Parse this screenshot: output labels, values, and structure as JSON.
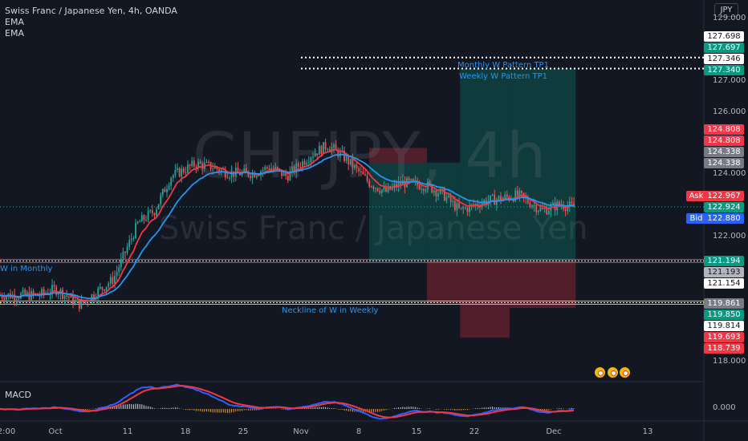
{
  "header": {
    "title_line": "Swiss Franc / Japanese Yen, 4h, OANDA",
    "indicators": [
      "EMA",
      "EMA"
    ]
  },
  "watermark": {
    "symbol": "CHFJPY, 4h",
    "name": "Swiss Franc / Japanese Yen"
  },
  "currency": "JPY",
  "colors": {
    "background": "#131722",
    "up": "#26a69a",
    "down": "#ef5350",
    "ema_fast": "#f23645",
    "ema_slow": "#2196f3",
    "neckline": "#f0d000",
    "annotation": "#2196f3"
  },
  "price_axis": {
    "ticks": [
      "129.000",
      "127.000",
      "126.000",
      "124.000",
      "122.000",
      "118.000"
    ],
    "tags": [
      {
        "value": "127.698",
        "style": "dark"
      },
      {
        "value": "127.697",
        "style": "green"
      },
      {
        "value": "127.346",
        "style": "dark"
      },
      {
        "value": "127.340",
        "style": "green"
      },
      {
        "value": "124.808",
        "style": "red"
      },
      {
        "value": "124.808",
        "style": "red"
      },
      {
        "value": "124.338",
        "style": "gray"
      },
      {
        "value": "124.338",
        "style": "gray"
      },
      {
        "value": "122.967",
        "style": "red"
      },
      {
        "value": "122.924",
        "style": "green"
      },
      {
        "value": "122.880",
        "style": "blue"
      },
      {
        "value": "121.194",
        "style": "green"
      },
      {
        "value": "121.193",
        "style": "gray"
      },
      {
        "value": "121.154",
        "style": "white"
      },
      {
        "value": "119.861",
        "style": "gray"
      },
      {
        "value": "119.850",
        "style": "green"
      },
      {
        "value": "119.814",
        "style": "white"
      },
      {
        "value": "119.693",
        "style": "red"
      },
      {
        "value": "118.739",
        "style": "red"
      }
    ],
    "ask_label": "Ask",
    "bid_label": "Bid"
  },
  "time_axis": {
    "labels": [
      "2:00",
      "Oct",
      "11",
      "18",
      "25",
      "Nov",
      "8",
      "15",
      "22",
      "Dec",
      "13"
    ]
  },
  "annotations": {
    "monthly_tp": "Monthly W Pattern TP1",
    "weekly_tp": "Weekly W Pattern TP1",
    "w_monthly": "W in Monthly",
    "neckline_weekly": "Neckline of W in Weekly"
  },
  "macd": {
    "label": "MACD",
    "axis_value": "0.000"
  },
  "chart_data": {
    "type": "candlestick",
    "title": "Swiss Franc / Japanese Yen, 4h, OANDA",
    "series": [
      {
        "name": "CHFJPY",
        "kind": "close",
        "x": [
          "Sep 29",
          "Oct 1",
          "Oct 4",
          "Oct 6",
          "Oct 8",
          "Oct 11",
          "Oct 13",
          "Oct 15",
          "Oct 18",
          "Oct 20",
          "Oct 22",
          "Oct 25",
          "Oct 27",
          "Oct 29",
          "Nov 1",
          "Nov 3",
          "Nov 5",
          "Nov 8",
          "Nov 10",
          "Nov 12",
          "Nov 15",
          "Nov 17",
          "Nov 19",
          "Nov 22",
          "Nov 24",
          "Nov 26",
          "Nov 29",
          "Dec 1",
          "Dec 3"
        ],
        "values": [
          120.1,
          120.3,
          119.8,
          120.2,
          120.6,
          122.4,
          122.8,
          123.9,
          124.3,
          124.2,
          124.0,
          124.0,
          124.2,
          123.9,
          124.6,
          124.9,
          124.5,
          123.7,
          123.4,
          123.7,
          123.6,
          123.3,
          122.8,
          123.1,
          123.2,
          123.3,
          122.8,
          123.0,
          122.9
        ]
      },
      {
        "name": "EMA",
        "kind": "ema_fast"
      },
      {
        "name": "EMA",
        "kind": "ema_slow"
      }
    ],
    "ylim": [
      117.5,
      129.5
    ],
    "levels": [
      {
        "name": "Monthly W Pattern TP1",
        "value": 127.698
      },
      {
        "name": "Weekly W Pattern TP1",
        "value": 127.346
      },
      {
        "name": "W in Monthly",
        "value": 121.194
      },
      {
        "name": "Neckline of W in Weekly",
        "value": 119.861
      }
    ],
    "positions": [
      {
        "start": "Nov 8",
        "end": "Nov 15",
        "entry": 124.338,
        "target": 121.194,
        "stop": 124.808,
        "direction": "short"
      },
      {
        "start": "Nov 15",
        "end": "Nov 19",
        "entry": 121.194,
        "target": 124.338,
        "stop": 119.861,
        "direction": "long"
      },
      {
        "start": "Nov 19",
        "end": "Nov 25",
        "entry": 121.194,
        "target": 127.346,
        "stop": 118.739,
        "direction": "long"
      },
      {
        "start": "Nov 25",
        "end": "Dec 3",
        "entry": 121.194,
        "target": 127.346,
        "stop": 119.693,
        "direction": "long"
      }
    ],
    "current": {
      "ask": 122.967,
      "last": 122.924,
      "bid": 122.88
    },
    "grid": false
  }
}
